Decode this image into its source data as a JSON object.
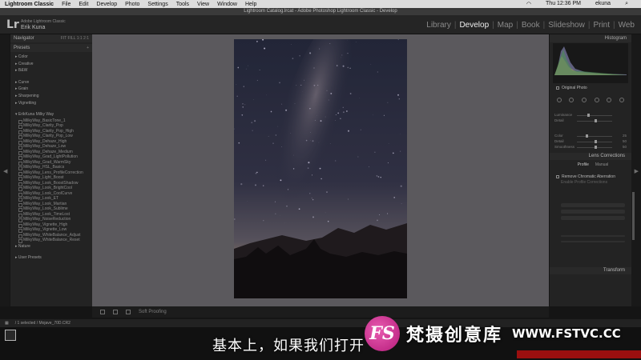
{
  "menubar": {
    "app": "Lightroom Classic",
    "items": [
      "File",
      "Edit",
      "Develop",
      "Photo",
      "Settings",
      "Tools",
      "View",
      "Window",
      "Help"
    ],
    "clock": "Thu 12:36 PM",
    "user": "ekuna"
  },
  "window": {
    "title": "Lightroom Catalog.lrcat - Adobe Photoshop Lightroom Classic - Develop"
  },
  "identity": {
    "logo": "Lr",
    "product": "Adobe Lightroom Classic",
    "user": "Erik Kuna"
  },
  "modules": [
    "Library",
    "Develop",
    "Map",
    "Book",
    "Slideshow",
    "Print",
    "Web"
  ],
  "active_module": "Develop",
  "left_panel": {
    "navigator": "Navigator",
    "navigator_zoom": "FIT  FILL  1:1  2:1",
    "presets": "Presets",
    "groups_top": [
      "Color",
      "Creative",
      "B&W"
    ],
    "groups_mid": [
      "Curve",
      "Grain",
      "Sharpening",
      "Vignetting"
    ],
    "user_group": "ErikKuna Milky Way",
    "user_presets": [
      "MilkyWay_BasicTone_1",
      "MilkyWay_Clarity_Pop",
      "MilkyWay_Clarity_Pop_High",
      "MilkyWay_Clarity_Pop_Low",
      "MilkyWay_Dehaze_High",
      "MilkyWay_Dehaze_Low",
      "MilkyWay_Dehaze_Medium",
      "MilkyWay_Grad_LightPollution",
      "MilkyWay_Grad_WarmSky",
      "MilkyWay_HSL_Basics",
      "MilkyWay_Lens_ProfileCorrection",
      "MilkyWay_Light_Boost",
      "MilkyWay_Look_BoostShadow",
      "MilkyWay_Look_BrightCool",
      "MilkyWay_Look_CoolCurve",
      "MilkyWay_Look_ET",
      "MilkyWay_Look_Martian",
      "MilkyWay_Look_Sublime",
      "MilkyWay_Look_TimeLost",
      "MilkyWay_NoiseReduction",
      "MilkyWay_Vignette_High",
      "MilkyWay_Vignette_Low",
      "MilkyWay_WhiteBalance_Adjust",
      "MilkyWay_WhiteBalance_Reset"
    ],
    "group_nature": "Nature",
    "user_presets_group": "User Presets"
  },
  "right_panel": {
    "histogram": "Histogram",
    "original_photo": "Original Photo",
    "sliders": [
      {
        "label": "Luminance",
        "value": "",
        "pos": 0.3
      },
      {
        "label": "Detail",
        "value": "",
        "pos": 0.5
      },
      {
        "label": "Color",
        "value": "25",
        "pos": 0.25
      },
      {
        "label": "Detail",
        "value": "50",
        "pos": 0.5
      },
      {
        "label": "Smoothness",
        "value": "50",
        "pos": 0.5
      }
    ],
    "lens_corrections": "Lens Corrections",
    "lens_tabs": [
      "Profile",
      "Manual"
    ],
    "remove_ca": "Remove Chromatic Aberration",
    "enable_profile": "Enable Profile Corrections",
    "transform": "Transform"
  },
  "toolbar": {
    "soft_proofing": "Soft Proofing"
  },
  "filmstrip": {
    "info": "/ 1 selected / Mojave_70D.CR2"
  },
  "overlay": {
    "subtitle": "基本上，如果我们打开",
    "watermark_logo": "FS",
    "watermark_cn": "梵摄创意库",
    "watermark_url": "WWW.FSTVC.CC"
  },
  "colors": {
    "accent": "#b51b7a",
    "center_bg": "#6f6d72",
    "panel_bg": "#2b2b2b"
  }
}
